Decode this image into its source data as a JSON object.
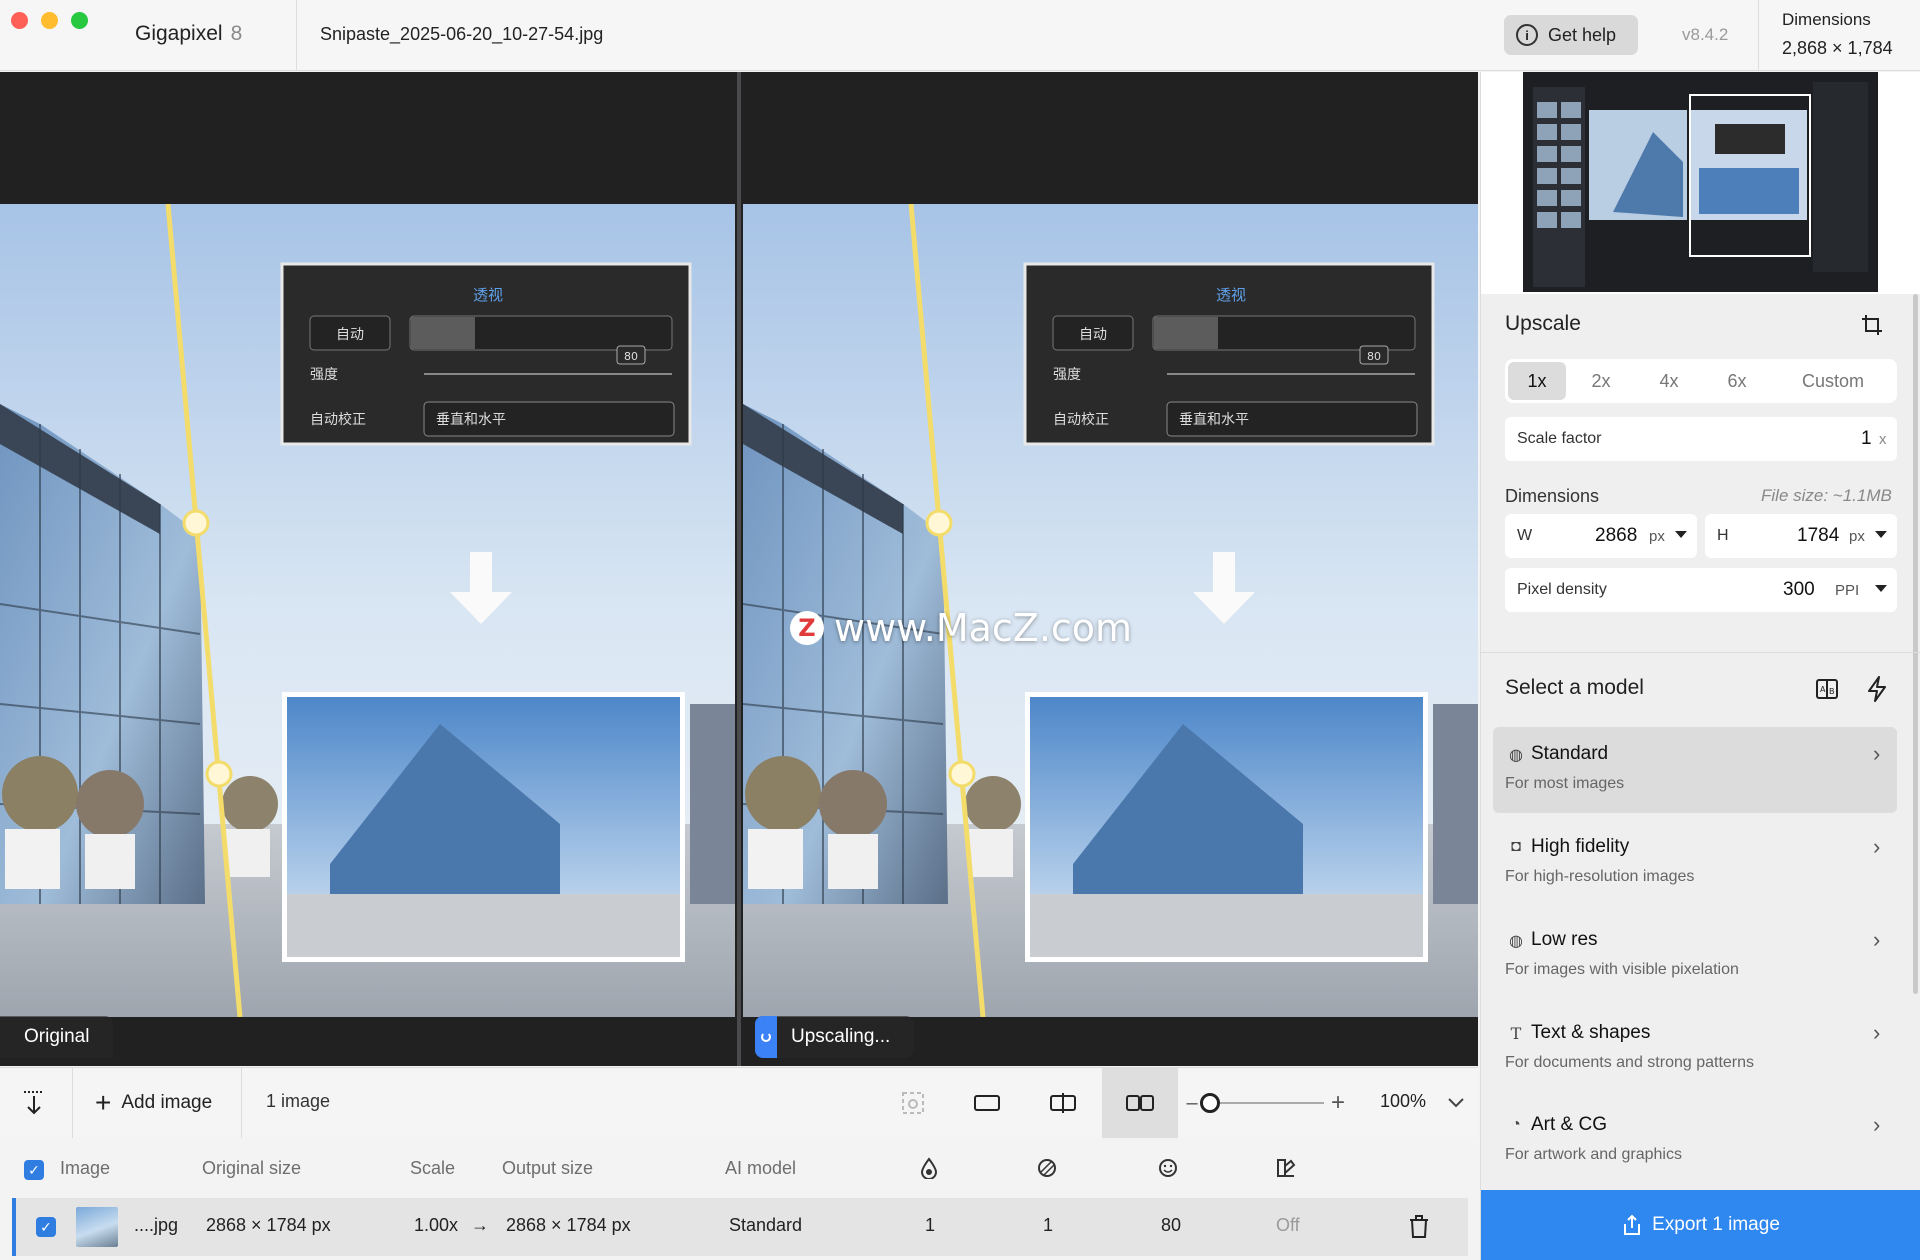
{
  "titlebar": {
    "app_name": "Gigapixel",
    "app_version": "8",
    "file_name": "Snipaste_2025-06-20_10-27-54.jpg",
    "help_label": "Get help",
    "version": "v8.4.2",
    "dimensions_title": "Dimensions",
    "dimensions_value": "2,868 × 1,784"
  },
  "viewer": {
    "left_label": "Original",
    "right_label": "Upscaling...",
    "watermark": "www.MacZ.com",
    "watermark_logo": "Z",
    "dialog": {
      "title": "透视",
      "auto_button": "自动",
      "strength_label": "强度",
      "strength_value": "80",
      "auto_correct_label": "自动校正",
      "auto_correct_value": "垂直和水平"
    }
  },
  "toolbar": {
    "add_image": "Add image",
    "image_count": "1 image",
    "zoom": "100%",
    "zoom_level": 0.08
  },
  "table": {
    "headers": {
      "image": "Image",
      "original_size": "Original size",
      "scale": "Scale",
      "output_size": "Output size",
      "ai_model": "AI model"
    },
    "row": {
      "name": "....jpg",
      "original_size": "2868 × 1784 px",
      "scale": "1.00x",
      "arrow": "→",
      "output_size": "2868 × 1784 px",
      "model": "Standard",
      "col1": "1",
      "col2": "1",
      "col3": "80",
      "col4": "Off"
    }
  },
  "panel": {
    "upscale_title": "Upscale",
    "scales": [
      "1x",
      "2x",
      "4x",
      "6x",
      "Custom"
    ],
    "selected_scale": "1x",
    "scale_factor_label": "Scale factor",
    "scale_factor_value": "1",
    "scale_factor_unit": "x",
    "dimensions_label": "Dimensions",
    "file_size": "File size: ~1.1MB",
    "width_label": "W",
    "width_value": "2868",
    "height_label": "H",
    "height_value": "1784",
    "px_unit": "px",
    "density_label": "Pixel density",
    "density_value": "300",
    "density_unit": "PPI",
    "model_title": "Select a model",
    "models": [
      {
        "name": "Standard",
        "desc": "For most images",
        "icon": "globe-icon"
      },
      {
        "name": "High fidelity",
        "desc": "For high-resolution images",
        "icon": "camera-icon"
      },
      {
        "name": "Low res",
        "desc": "For images with visible pixelation",
        "icon": "globe-icon"
      },
      {
        "name": "Text & shapes",
        "desc": "For documents and strong patterns",
        "icon": "text-icon"
      },
      {
        "name": "Art & CG",
        "desc": "For artwork and graphics",
        "icon": "palette-icon"
      }
    ],
    "export_label": "Export 1 image"
  },
  "colors": {
    "accent": "#2f87f0",
    "viewer_bg": "#212122",
    "guide_line": "#f3dc6a"
  }
}
